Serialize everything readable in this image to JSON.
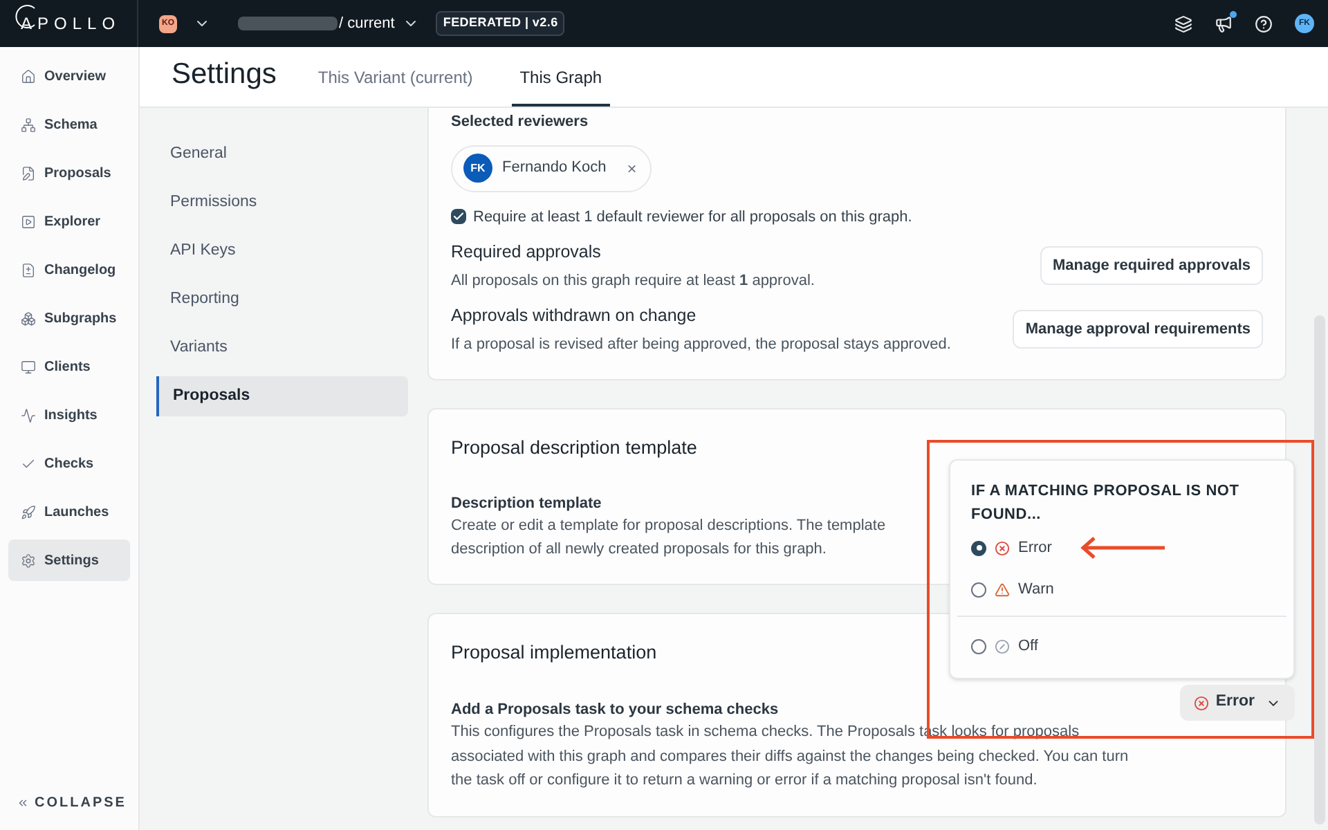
{
  "top_bar": {
    "logo": "APOLLO",
    "org_badge": "KO",
    "graph_suffix": "/ current",
    "federation_badge": "FEDERATED | v2.6",
    "avatar": "FK",
    "notification": true
  },
  "sidebar": {
    "items": [
      {
        "label": "Overview",
        "selected": false
      },
      {
        "label": "Schema",
        "selected": false
      },
      {
        "label": "Proposals",
        "selected": false
      },
      {
        "label": "Explorer",
        "selected": false
      },
      {
        "label": "Changelog",
        "selected": false
      },
      {
        "label": "Subgraphs",
        "selected": false
      },
      {
        "label": "Clients",
        "selected": false
      },
      {
        "label": "Insights",
        "selected": false
      },
      {
        "label": "Checks",
        "selected": false
      },
      {
        "label": "Launches",
        "selected": false
      },
      {
        "label": "Settings",
        "selected": true
      }
    ],
    "collapse": "COLLAPSE"
  },
  "header": {
    "title": "Settings",
    "tabs": [
      {
        "label": "This Variant (current)",
        "selected": false
      },
      {
        "label": "This Graph",
        "selected": true
      }
    ]
  },
  "settings_nav": {
    "items": [
      {
        "label": "General",
        "selected": false
      },
      {
        "label": "Permissions",
        "selected": false
      },
      {
        "label": "API Keys",
        "selected": false
      },
      {
        "label": "Reporting",
        "selected": false
      },
      {
        "label": "Variants",
        "selected": false
      },
      {
        "label": "Proposals",
        "selected": true
      }
    ]
  },
  "reviewers": {
    "heading": "Selected reviewers",
    "reviewer": {
      "initials": "FK",
      "name": "Fernando Koch",
      "remove": "×"
    },
    "require_default": {
      "label": "Require at least 1 default reviewer for all proposals on this graph.",
      "checked": true
    },
    "sections": [
      {
        "title": "Required approvals",
        "text": "All proposals on this graph require at least **1** approval.",
        "button": "Manage required approvals"
      },
      {
        "title": "Approvals withdrawn on change",
        "text": "If a proposal is revised after being approved, the proposal stays approved.",
        "button": "Manage approval requirements"
      }
    ]
  },
  "template_card": {
    "title": "Proposal description template",
    "subtitle": "Description template",
    "lines": [
      "Create or edit a template for proposal descriptions. The template",
      "description of all newly created proposals for this graph."
    ]
  },
  "implementation_card": {
    "title": "Proposal implementation",
    "subtitle": "Add a Proposals task to your schema checks",
    "text": "This configures the Proposals task in schema checks. The Proposals task looks for proposals associated with this graph and compares their diffs against the changes being checked. You can turn the task off or configure it to return a warning or error if a matching proposal isn't found.",
    "dropdown": {
      "value": "Error",
      "menu_title": "IF A MATCHING PROPOSAL IS NOT FOUND...",
      "options": [
        {
          "kind": "error",
          "label": "Error",
          "selected": true
        },
        {
          "kind": "warn",
          "label": "Warn",
          "selected": false
        },
        {
          "kind": "off",
          "label": "Off",
          "selected": false
        }
      ]
    }
  }
}
